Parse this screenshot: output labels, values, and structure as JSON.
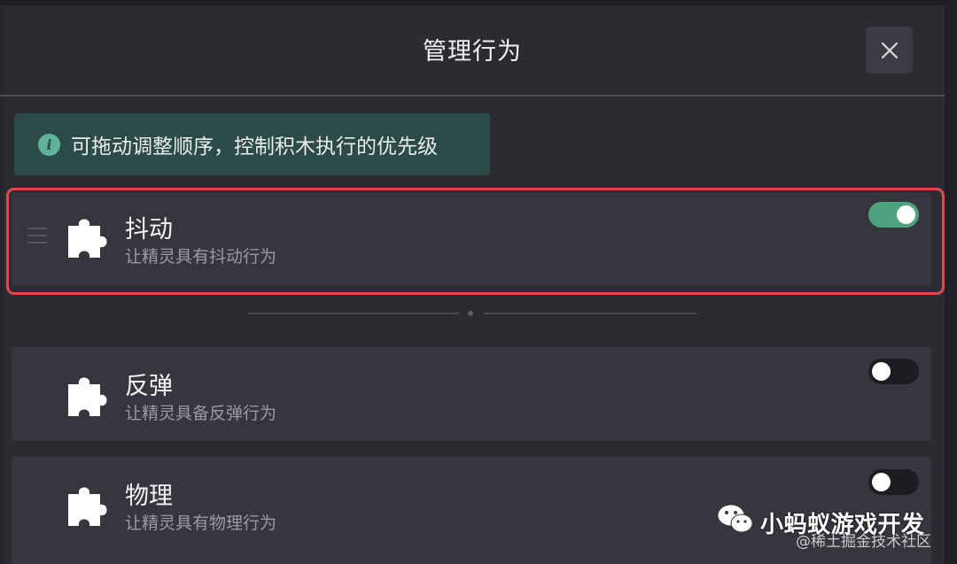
{
  "dialog": {
    "title": "管理行为",
    "close_icon": "close-icon"
  },
  "tip": {
    "icon": "info-icon",
    "text": "可拖动调整顺序，控制积木执行的优先级"
  },
  "behaviors": [
    {
      "name": "抖动",
      "description": "让精灵具有抖动行为",
      "enabled": true,
      "selected": true,
      "icon": "puzzle-piece-icon"
    },
    {
      "name": "反弹",
      "description": "让精灵具备反弹行为",
      "enabled": false,
      "selected": false,
      "icon": "puzzle-piece-icon"
    },
    {
      "name": "物理",
      "description": "让精灵具有物理行为",
      "enabled": false,
      "selected": false,
      "icon": "puzzle-piece-icon"
    }
  ],
  "watermark": {
    "name": "小蚂蚁游戏开发",
    "source": "@稀土掘金技术社区",
    "icon": "wechat-icon"
  },
  "colors": {
    "background": "#2b2c32",
    "card": "#36373e",
    "tip_background": "#2c4a47",
    "toggle_on": "#4fa27f",
    "selection_border": "#e2474b"
  }
}
